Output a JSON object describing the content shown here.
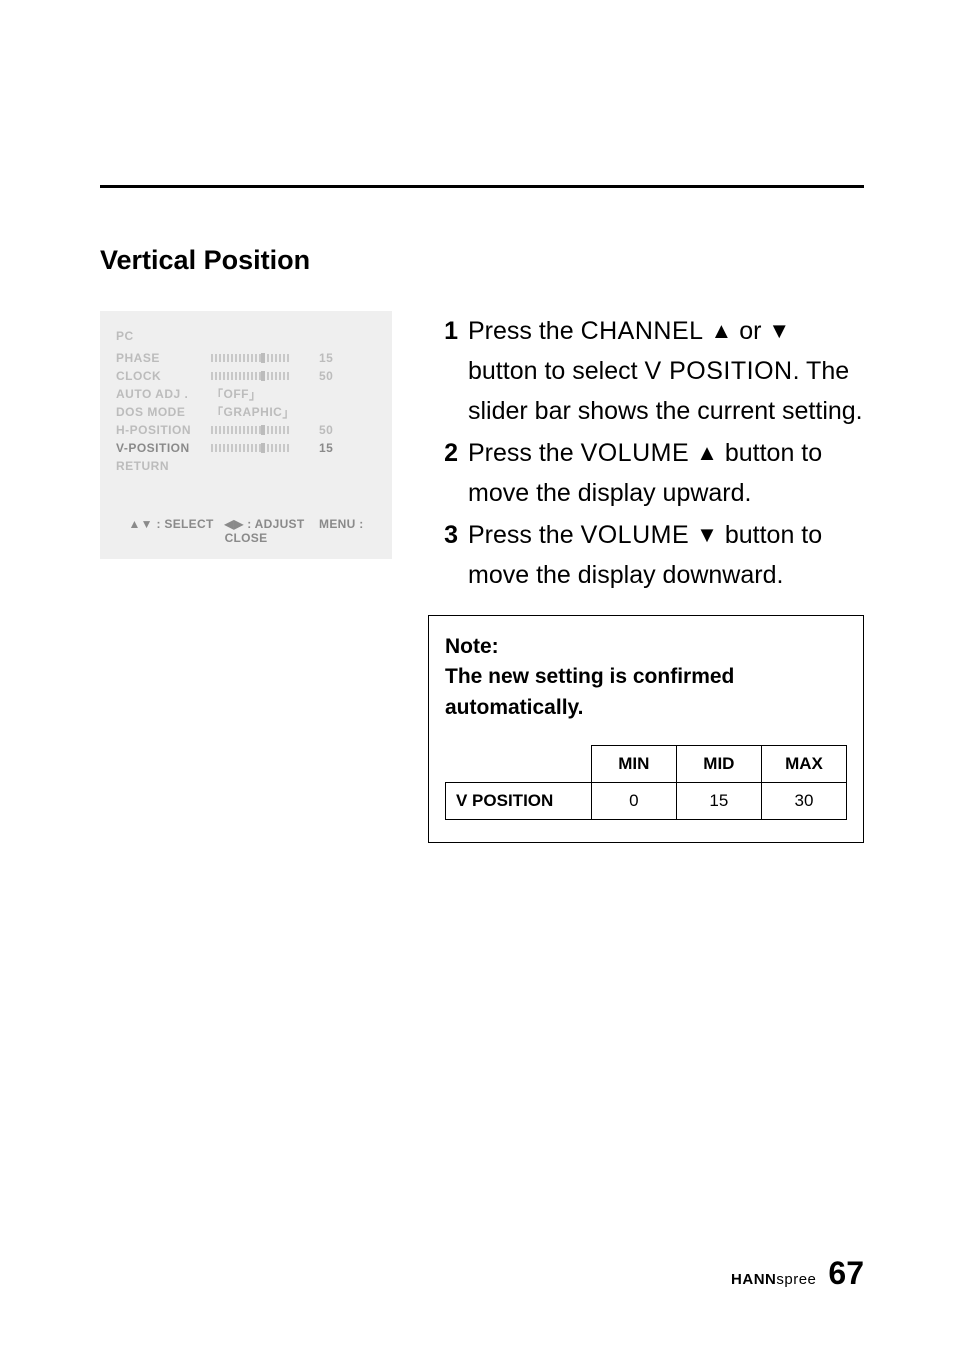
{
  "section_title": "Vertical Position",
  "osd": {
    "header": "PC",
    "rows": [
      {
        "label": "PHASE",
        "type": "slider",
        "value": "15",
        "active": false
      },
      {
        "label": "CLOCK",
        "type": "slider",
        "value": "50",
        "active": false
      },
      {
        "label": "AUTO ADJ .",
        "type": "bracket",
        "value": "OFF",
        "active": false
      },
      {
        "label": "DOS MODE",
        "type": "bracket",
        "value": "GRAPHIC",
        "active": false
      },
      {
        "label": "H-POSITION",
        "type": "slider",
        "value": "50",
        "active": false
      },
      {
        "label": "V-POSITION",
        "type": "slider",
        "value": "15",
        "active": true
      },
      {
        "label": "RETURN",
        "type": "none",
        "value": "",
        "active": false
      }
    ],
    "footer_select": ": SELECT",
    "footer_adjust": ": ADJUST",
    "footer_close": "MENU : CLOSE"
  },
  "steps": [
    {
      "num": "1",
      "pre": "Press the ",
      "sc1": "CHANNEL",
      "mid1": "  ",
      "tri1": "▲",
      "mid2": " or ",
      "tri2": "▼",
      "post1": " button to select ",
      "sc2": "V POSITION",
      "post2": ". The slider bar shows the current setting."
    },
    {
      "num": "2",
      "pre": "Press the ",
      "sc1": "VOLUME",
      "mid1": " ",
      "tri1": "▲",
      "post1": " button to move the display upward."
    },
    {
      "num": "3",
      "pre": "Press the ",
      "sc1": "VOLUME",
      "mid1": " ",
      "tri1": "▼",
      "post1": " button to move the display downward."
    }
  ],
  "note": {
    "label": "Note:",
    "text": "The new setting is confirmed automatically.",
    "table": {
      "headers": [
        "MIN",
        "MID",
        "MAX"
      ],
      "row_label": "V POSITION",
      "values": [
        "0",
        "15",
        "30"
      ]
    }
  },
  "footer": {
    "brand_bold": "HANN",
    "brand_light": "spree",
    "page": "67"
  }
}
